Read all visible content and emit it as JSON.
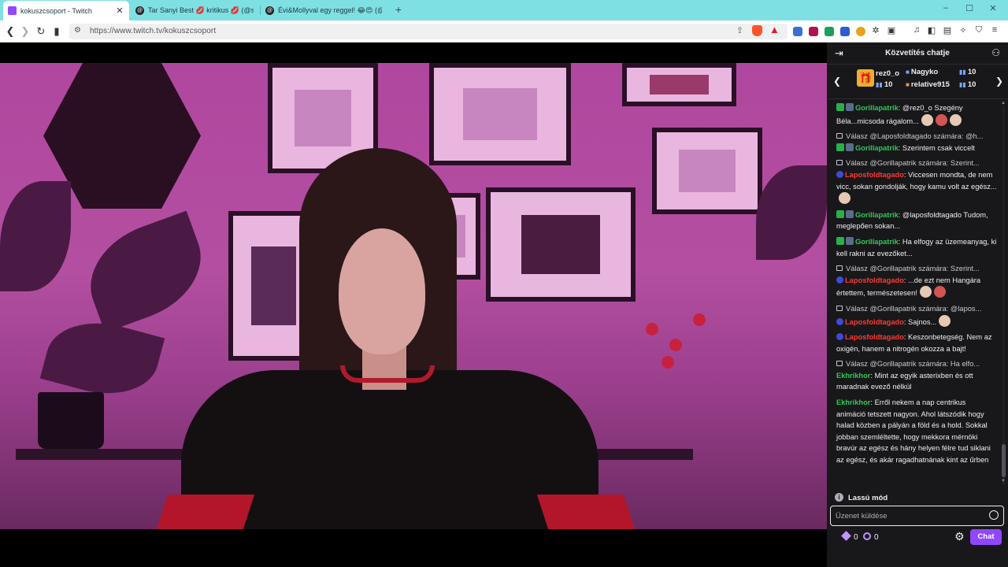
{
  "browser": {
    "tabs": [
      {
        "title": "kokuszcsoport - Twitch",
        "icon": "twitch-icon",
        "active": true
      },
      {
        "title": "Tar Sanyi Best 💋 kritikus 💋 (@szop",
        "icon": "threads-icon",
        "active": false
      },
      {
        "title": "Évi&Mollyval egy reggel! 😂😍 (@m",
        "icon": "threads-icon",
        "active": false
      }
    ],
    "new_tab": "+",
    "window_controls": [
      "–",
      "☐",
      "✕"
    ],
    "url": "https://www.twitch.tv/kokuszcsoport",
    "accent": "#7fe0e4"
  },
  "chat": {
    "header_title": "Közvetítés chatje",
    "leaderboard": [
      {
        "name": "rez0_o",
        "count": "10"
      },
      {
        "name": "Nagyko",
        "count": "10"
      },
      {
        "name": "relative915",
        "count": "10"
      }
    ],
    "messages": [
      {
        "badges": [
          "mod",
          "vip"
        ],
        "user": "Gorillapatrik",
        "color": "green",
        "text": ": @rez0_o Szegény Béla...micsoda rágalom...",
        "emotes": 3
      },
      {
        "reply": "Válasz @Laposfoldtagado számára: @h...",
        "badges": [
          "mod",
          "vip"
        ],
        "user": "Gorillapatrik",
        "color": "green",
        "text": ": Szerintem csak viccelt",
        "emotes": 0
      },
      {
        "reply": "Válasz @Gorillapatrik számára: Szerint...",
        "badges": [
          "sub"
        ],
        "user": "Laposfoldtagado",
        "color": "red",
        "text": ": Viccesen mondta, de nem vicc, sokan gondolják, hogy kamu volt az egész...",
        "emotes": 1
      },
      {
        "badges": [
          "mod",
          "vip"
        ],
        "user": "Gorillapatrik",
        "color": "green",
        "text": ": @laposfoldtagado Tudom, meglepően sokan...",
        "emotes": 0
      },
      {
        "badges": [
          "mod",
          "vip"
        ],
        "user": "Gorillapatrik",
        "color": "green",
        "text": ": Ha elfogy az üzemeanyag, ki kell rakni az evezőket...",
        "emotes": 0
      },
      {
        "reply": "Válasz @Gorillapatrik számára: Szerint...",
        "badges": [
          "sub"
        ],
        "user": "Laposfoldtagado",
        "color": "red",
        "text": ": ...de ezt nem Hangára értettem, természetesen!",
        "emotes": 2
      },
      {
        "reply": "Válasz @Gorillapatrik számára: @lapos...",
        "badges": [
          "sub"
        ],
        "user": "Laposfoldtagado",
        "color": "red",
        "text": ": Sajnos...",
        "emotes": 1
      },
      {
        "badges": [
          "sub"
        ],
        "user": "Laposfoldtagado",
        "color": "red",
        "text": ": Keszonbetegség. Nem az oxigén, hanem a nitrogén okozza a bajt!",
        "emotes": 0
      },
      {
        "reply": "Válasz @Gorillapatrik számára: Ha elfo...",
        "badges": [],
        "user": "Ekhrikhor",
        "color": "green",
        "text": ": Mint az egyik asterixben és ott maradnak evező nélkül",
        "emotes": 0
      },
      {
        "badges": [],
        "user": "Ekhrikhor",
        "color": "green",
        "text": ": Erről nekem a nap centrikus animáció tetszett nagyon. Ahol látszódik hogy halad közben a pályán a föld és a hold. Sokkal jobban szemléltette, hogy mekkora mérnöki bravúr az egész és hány helyen félre tud siklani az egész, és akár ragadhatnának kint az űrben",
        "emotes": 0
      }
    ],
    "slow_mode_label": "Lassú mód",
    "input_placeholder": "Üzenet küldése",
    "points": "0",
    "predictions": "0",
    "chat_button": "Chat",
    "accent": "#9147ff"
  }
}
